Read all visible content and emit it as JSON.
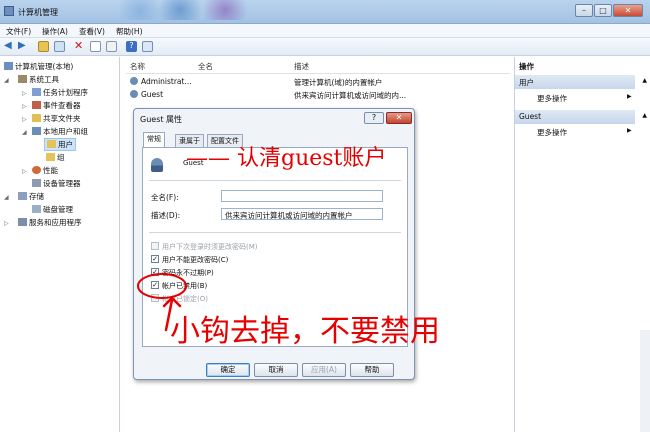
{
  "window": {
    "title": "计算机管理",
    "min": "–",
    "max": "□",
    "close": "✕"
  },
  "menu": [
    "文件(F)",
    "操作(A)",
    "查看(V)",
    "帮助(H)"
  ],
  "tree": {
    "root": "计算机管理(本地)",
    "system_tools": "系统工具",
    "task_scheduler": "任务计划程序",
    "event_viewer": "事件查看器",
    "shared_folders": "共享文件夹",
    "local_users": "本地用户和组",
    "users": "用户",
    "groups": "组",
    "performance": "性能",
    "device_manager": "设备管理器",
    "storage": "存储",
    "disk_management": "磁盘管理",
    "services": "服务和应用程序"
  },
  "list": {
    "columns": [
      "名称",
      "全名",
      "描述"
    ],
    "rows": [
      {
        "name": "Administrat...",
        "full": "",
        "desc": "管理计算机(域)的内置帐户"
      },
      {
        "name": "Guest",
        "full": "",
        "desc": "供来宾访问计算机或访问域的内..."
      }
    ]
  },
  "actions": {
    "header": "操作",
    "users_section": "用户",
    "more1": "更多操作",
    "guest_section": "Guest",
    "more2": "更多操作"
  },
  "dialog": {
    "title": "Guest 属性",
    "help": "?",
    "close": "✕",
    "tabs": [
      "常规",
      "隶属于",
      "配置文件"
    ],
    "username": "Guest",
    "fullname_label": "全名(F):",
    "fullname_value": "",
    "desc_label": "描述(D):",
    "desc_value": "供来宾访问计算机或访问域的内置帐户",
    "checks": [
      {
        "label": "用户下次登录时须更改密码(M)",
        "checked": false,
        "disabled": true
      },
      {
        "label": "用户不能更改密码(C)",
        "checked": true,
        "disabled": false
      },
      {
        "label": "密码永不过期(P)",
        "checked": true,
        "disabled": false
      },
      {
        "label": "帐户已禁用(B)",
        "checked": true,
        "disabled": false
      },
      {
        "label": "帐户已锁定(O)",
        "checked": false,
        "disabled": true
      }
    ],
    "buttons": {
      "ok": "确定",
      "cancel": "取消",
      "apply": "应用(A)",
      "help": "帮助"
    }
  },
  "annotations": {
    "top": "—— 认清guest账户",
    "bottom": "小钩去掉，不要禁用"
  },
  "colors": {
    "annotation": "#e60000",
    "selection": "#cce4f7",
    "title_bar": "#b9d3ee"
  }
}
